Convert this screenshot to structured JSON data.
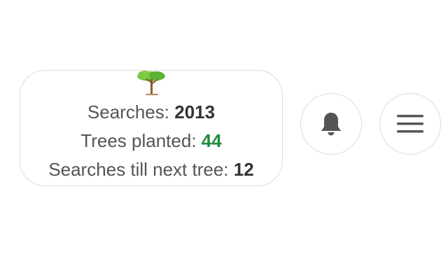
{
  "stats": {
    "searches_label": "Searches:",
    "searches_value": "2013",
    "trees_label": "Trees planted:",
    "trees_value": "44",
    "next_tree_label": "Searches till next tree:",
    "next_tree_value": "12"
  },
  "icons": {
    "tree": "tree-icon",
    "bell": "bell-icon",
    "menu": "hamburger-menu-icon"
  },
  "colors": {
    "trees_value": "#1e8a3a",
    "icon": "#555555",
    "border": "#dcdcdc"
  }
}
